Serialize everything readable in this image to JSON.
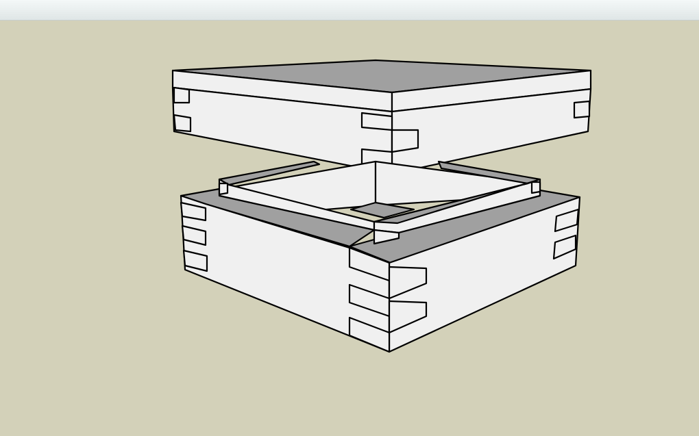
{
  "app": {
    "toolbar": {},
    "viewport": {
      "model": "box-with-dovetail-joints",
      "colors": {
        "background": "#d3d1b9",
        "face_light": "#f0f0f0",
        "face_shaded": "#a0a0a0",
        "edge": "#000000"
      }
    }
  }
}
